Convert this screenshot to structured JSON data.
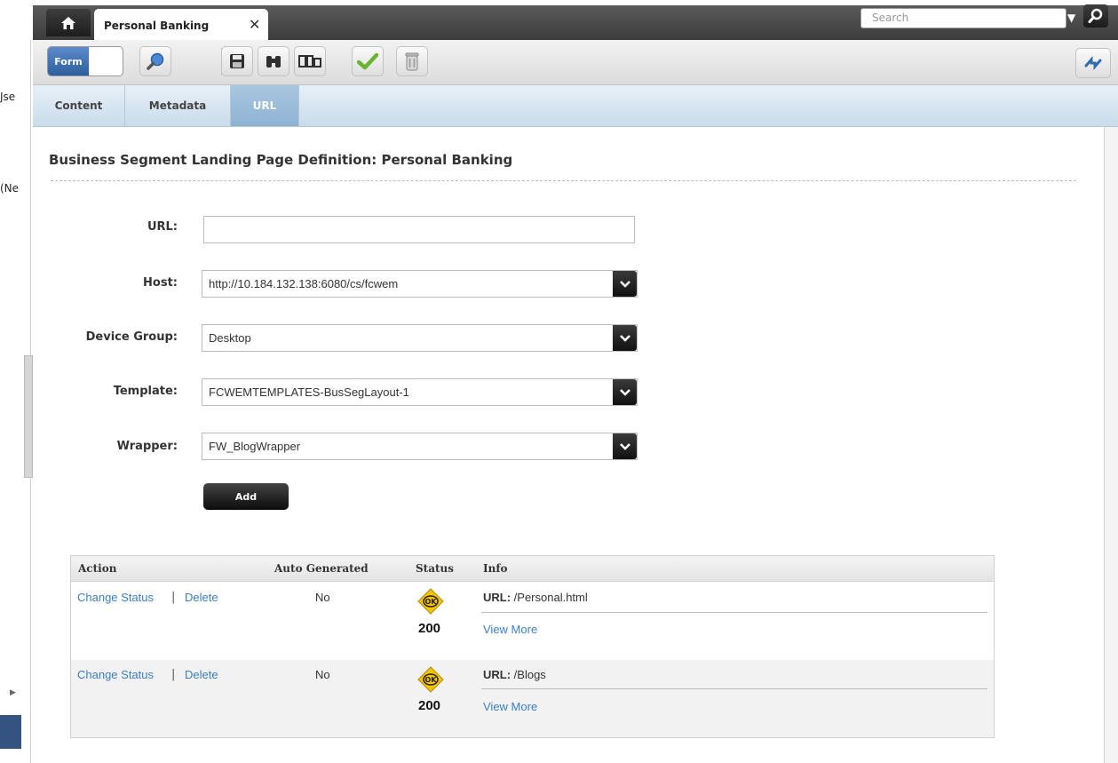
{
  "tabs": {
    "active_label": "Personal Banking",
    "close_glyph": "✕"
  },
  "search": {
    "placeholder": "Search"
  },
  "left_panel": {
    "fragments": [
      "Jse",
      "(Ne"
    ]
  },
  "toolbar": {
    "form_label": "Form",
    "buttons": [
      "search-icon",
      "save-icon",
      "binoculars-icon",
      "preview-icon",
      "approve-icon",
      "delete-icon"
    ],
    "right_button": "sync-icon"
  },
  "subtabs": [
    {
      "label": "Content",
      "active": false
    },
    {
      "label": "Metadata",
      "active": false
    },
    {
      "label": "URL",
      "active": true
    }
  ],
  "page": {
    "title": "Business Segment Landing Page Definition: Personal Banking"
  },
  "form": {
    "url_label": "URL:",
    "url_value": "",
    "host_label": "Host:",
    "host_value": "http://10.184.132.138:6080/cs/fcwem",
    "device_group_label": "Device Group:",
    "device_group_value": "Desktop",
    "template_label": "Template:",
    "template_value": "FCWEMTEMPLATES-BusSegLayout-1",
    "wrapper_label": "Wrapper:",
    "wrapper_value": "FW_BlogWrapper",
    "add_label": "Add"
  },
  "table": {
    "headers": {
      "action": "Action",
      "auto_generated": "Auto Generated",
      "status": "Status",
      "info": "Info"
    },
    "rows": [
      {
        "change_status": "Change Status",
        "separator": "|",
        "delete": "Delete",
        "auto_generated": "No",
        "status_badge": "OK",
        "status_code": "200",
        "info_key": "URL:",
        "info_value": "/Personal.html",
        "view_more": "View More"
      },
      {
        "change_status": "Change Status",
        "separator": "|",
        "delete": "Delete",
        "auto_generated": "No",
        "status_badge": "OK",
        "status_code": "200",
        "info_key": "URL:",
        "info_value": "/Blogs",
        "view_more": "View More"
      }
    ]
  },
  "colors": {
    "link": "#3a7fc1",
    "active_tab": "#9dbfdc",
    "form_toggle": "#3d6fb0",
    "ok_badge": "#f5c400"
  }
}
